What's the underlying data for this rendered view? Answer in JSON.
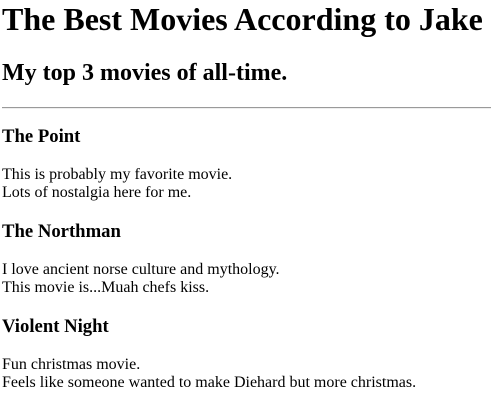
{
  "page": {
    "title": "The Best Movies According to Jake",
    "subtitle": "My top 3 movies of all-time."
  },
  "movies": [
    {
      "title": "The Point",
      "lines": [
        "This is probably my favorite movie.",
        "Lots of nostalgia here for me."
      ]
    },
    {
      "title": "The Northman",
      "lines": [
        "I love ancient norse culture and mythology.",
        "This movie is...Muah chefs kiss."
      ]
    },
    {
      "title": "Violent Night",
      "lines": [
        "Fun christmas movie.",
        "Feels like someone wanted to make Diehard but more christmas."
      ]
    }
  ]
}
